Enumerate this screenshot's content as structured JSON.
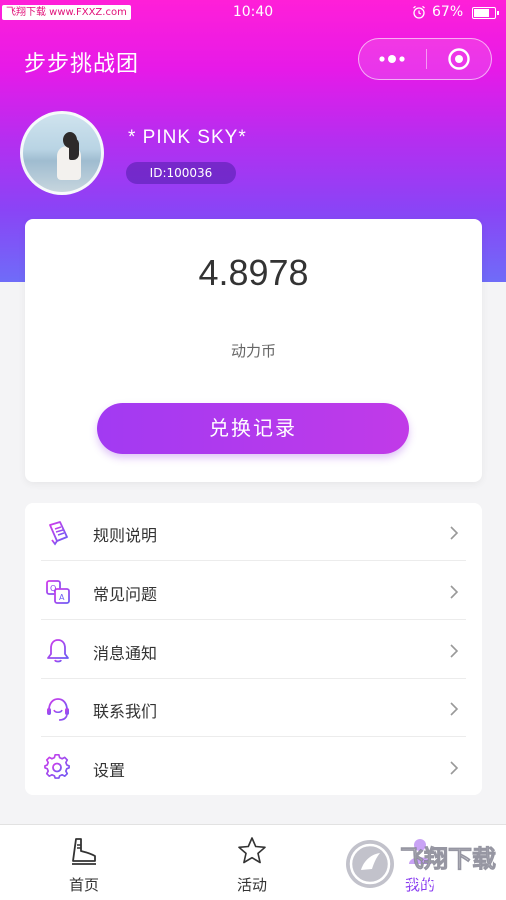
{
  "status_bar": {
    "watermark": "飞翔下载 www.FXXZ.com",
    "time": "10:40",
    "battery": "67%",
    "battery_level": 0.67
  },
  "nav": {
    "title": "步步挑战团"
  },
  "profile": {
    "username": "* PINK SKY*",
    "id": "ID:100036"
  },
  "balance": {
    "amount": "4.8978",
    "unit": "动力币",
    "button_label": "兑换记录"
  },
  "menu": {
    "items": [
      {
        "label": "规则说明",
        "icon": "rules-icon"
      },
      {
        "label": "常见问题",
        "icon": "faq-icon"
      },
      {
        "label": "消息通知",
        "icon": "bell-icon"
      },
      {
        "label": "联系我们",
        "icon": "support-icon"
      },
      {
        "label": "设置",
        "icon": "gear-icon"
      }
    ]
  },
  "tabbar": {
    "tabs": [
      {
        "label": "首页",
        "icon": "shoe-icon"
      },
      {
        "label": "活动",
        "icon": "star-icon"
      },
      {
        "label": "我的",
        "icon": "user-icon"
      }
    ]
  },
  "corner_watermark": {
    "text": "飞翔下载",
    "url": "www.FXXZ.com"
  },
  "colors": {
    "header_top": "#ff1fd8",
    "header_bottom": "#6f6cf8",
    "accent": "#a23af2",
    "icon_purple": "#8a3df0"
  }
}
